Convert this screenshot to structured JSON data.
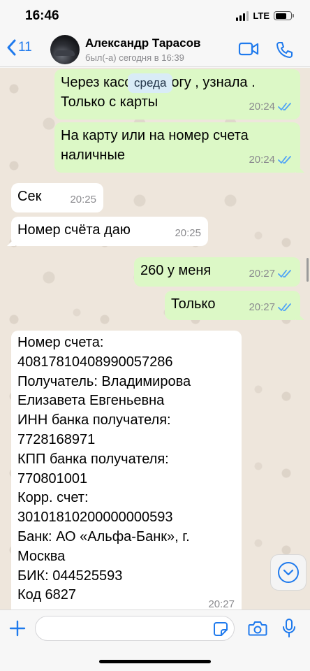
{
  "status_bar": {
    "time": "16:46",
    "network": "LTE",
    "battery_level": 0.75
  },
  "header": {
    "back_count": "11",
    "contact_name": "Александр Тарасов",
    "last_seen": "был(-а) сегодня в 16:39",
    "icons": {
      "back": "chevron-left-icon",
      "video": "video-camera-icon",
      "call": "phone-icon"
    }
  },
  "chat": {
    "day_separator": "среда",
    "messages": [
      {
        "direction": "out",
        "lines": [
          "Через кассу не могу , узнала .",
          "Только с карты"
        ],
        "time": "20:24",
        "status": "read"
      },
      {
        "direction": "out",
        "lines": [
          "На карту или на номер счета",
          "наличные"
        ],
        "time": "20:24",
        "status": "read"
      },
      {
        "direction": "in",
        "lines": [
          "Сек"
        ],
        "time": "20:25"
      },
      {
        "direction": "in",
        "lines": [
          "Номер счёта даю"
        ],
        "time": "20:25"
      },
      {
        "direction": "out",
        "lines": [
          "260 у меня"
        ],
        "time": "20:27",
        "status": "read"
      },
      {
        "direction": "out",
        "lines": [
          "Только"
        ],
        "time": "20:27",
        "status": "read"
      },
      {
        "direction": "in",
        "lines": [
          "Номер счета:",
          "40817810408990057286",
          "Получатель: Владимирова",
          "Елизавета Евгеньевна",
          "ИНН банка получателя:",
          "7728168971",
          "КПП банка получателя:",
          "770801001",
          "Корр. счет:",
          "30101810200000000593",
          "Банк: АО «Альфа-Банк», г.",
          "Москва",
          "БИК: 044525593",
          "Код 6827"
        ],
        "time": "20:27"
      }
    ]
  },
  "input_bar": {
    "placeholder": "",
    "icons": {
      "attach": "plus-icon",
      "sticker": "sticker-icon",
      "camera": "camera-icon",
      "mic": "microphone-icon"
    }
  },
  "colors": {
    "accent": "#1f7aed",
    "outgoing_bubble": "#dcf8c6",
    "incoming_bubble": "#ffffff",
    "read_ticks": "#4fa3f7",
    "chat_background": "#eee6dc"
  }
}
